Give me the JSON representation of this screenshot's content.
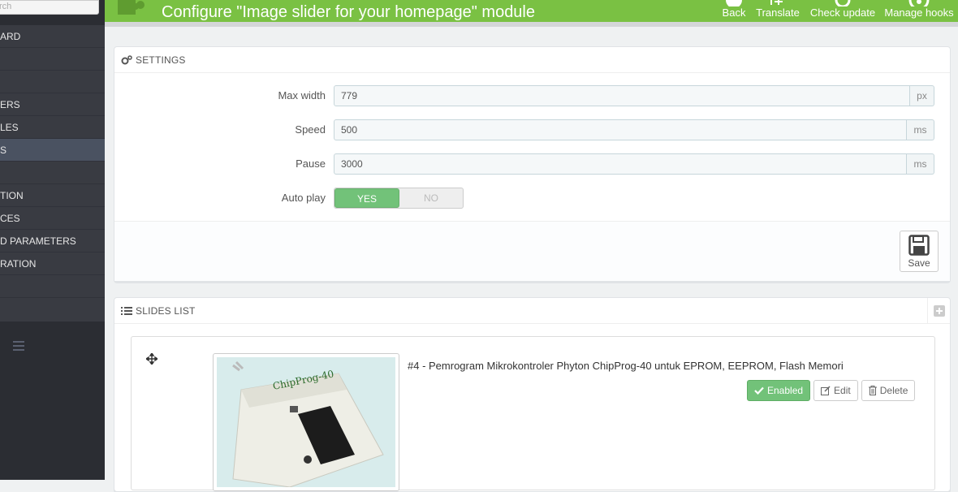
{
  "sidebar": {
    "search_placeholder": "rch",
    "items": [
      {
        "label": "ARD",
        "active": false
      },
      {
        "label": "",
        "active": false
      },
      {
        "label": "",
        "active": false
      },
      {
        "label": "ERS",
        "active": false
      },
      {
        "label": "LES",
        "active": false
      },
      {
        "label": "S",
        "active": true
      },
      {
        "label": "",
        "active": false
      },
      {
        "label": "TION",
        "active": false
      },
      {
        "label": "CES",
        "active": false
      },
      {
        "label": "D PARAMETERS",
        "active": false
      },
      {
        "label": "RATION",
        "active": false
      },
      {
        "label": "",
        "active": false
      }
    ]
  },
  "header": {
    "title": "Configure \"Image slider for your homepage\" module",
    "toolbar": {
      "back": "Back",
      "translate": "Translate",
      "check_update": "Check update",
      "manage_hooks": "Manage hooks"
    }
  },
  "settings": {
    "heading": "SETTINGS",
    "max_width": {
      "label": "Max width",
      "value": "779",
      "unit": "px"
    },
    "speed": {
      "label": "Speed",
      "value": "500",
      "unit": "ms"
    },
    "pause": {
      "label": "Pause",
      "value": "3000",
      "unit": "ms"
    },
    "auto_play": {
      "label": "Auto play",
      "yes": "YES",
      "no": "NO",
      "selected": "YES"
    },
    "save_label": "Save"
  },
  "slides": {
    "heading": "SLIDES LIST",
    "items": [
      {
        "title": "#4 - Pemrogram Mikrokontroler Phyton ChipProg-40 untuk EPROM, EEPROM, Flash Memori",
        "status": "Enabled",
        "edit": "Edit",
        "delete": "Delete"
      }
    ]
  },
  "colors": {
    "accent": "#7ac143",
    "success": "#72c279",
    "sidebar_bg": "#393b42"
  }
}
